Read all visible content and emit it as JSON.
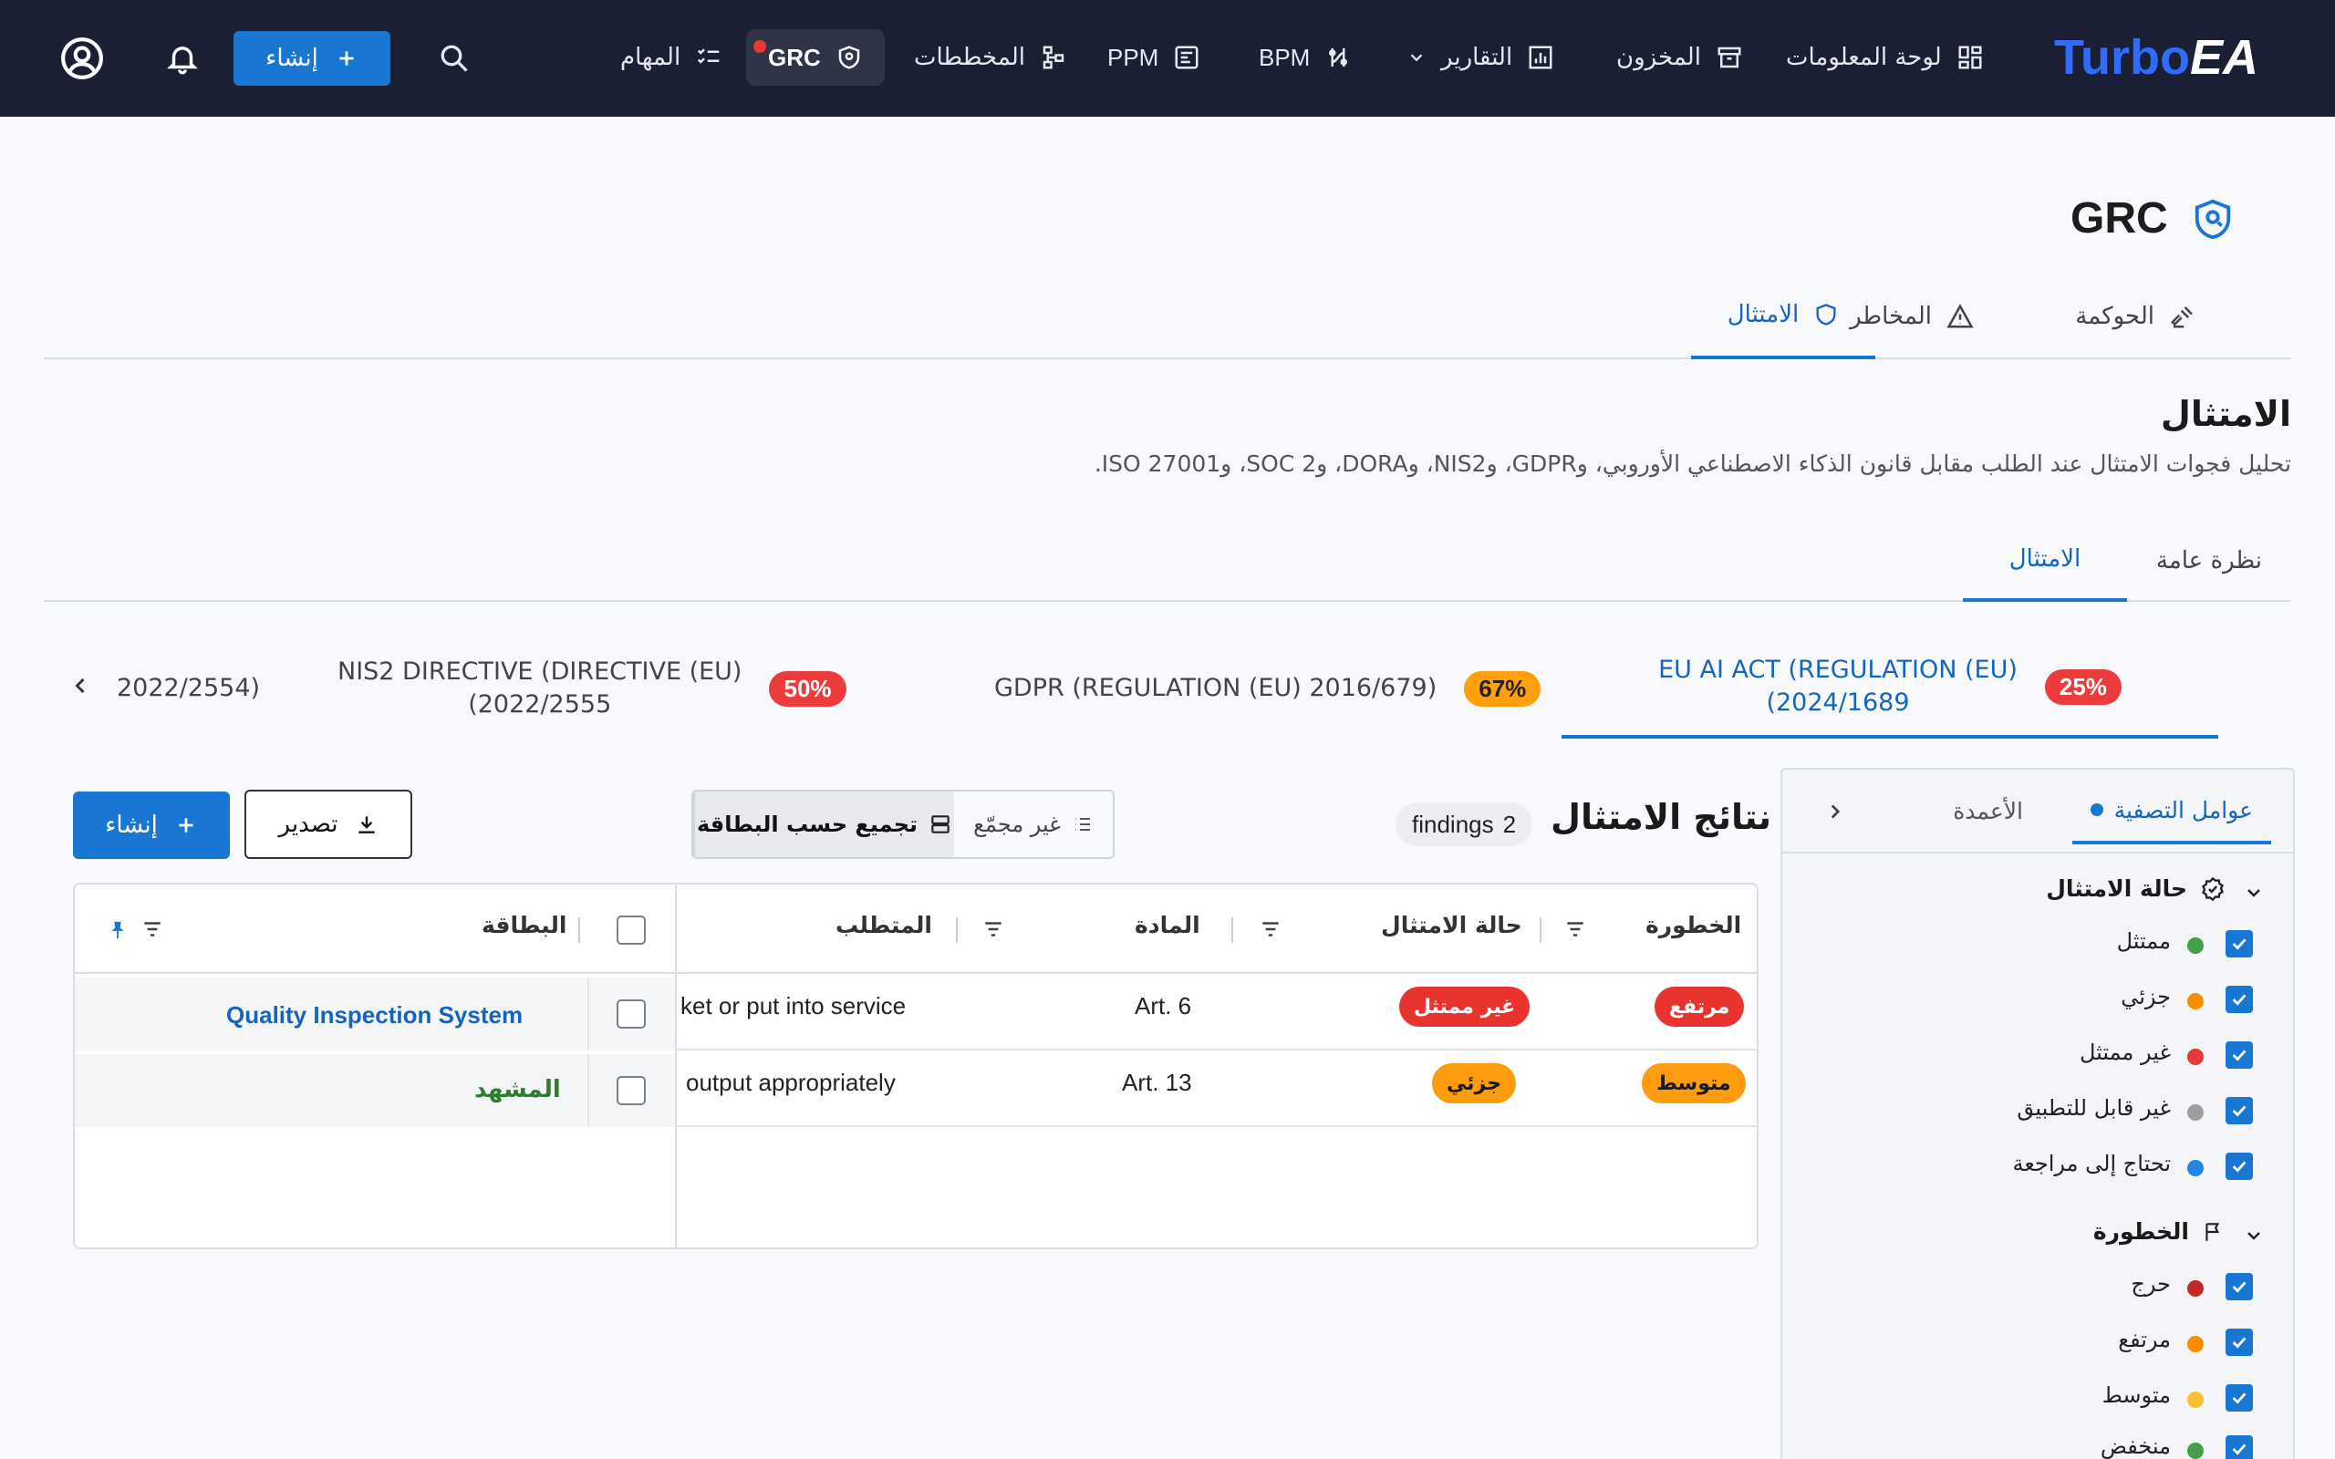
{
  "nav": {
    "logo_a": "Turbo",
    "logo_b": "EA",
    "items": [
      {
        "label": "لوحة المعلومات"
      },
      {
        "label": "المخزون"
      },
      {
        "label": "التقارير"
      },
      {
        "label": "BPM"
      },
      {
        "label": "PPM"
      },
      {
        "label": "المخططات"
      },
      {
        "label": "GRC",
        "active": true
      },
      {
        "label": "المهام"
      }
    ],
    "create_label": "إنشاء"
  },
  "page": {
    "title": "GRC",
    "tabs": [
      {
        "label": "الحوكمة"
      },
      {
        "label": "المخاطر"
      },
      {
        "label": "الامتثال",
        "active": true
      }
    ],
    "section_title": "الامتثال",
    "section_desc": "تحليل فجوات الامتثال عند الطلب مقابل قانون الذكاء الاصطناعي الأوروبي، وGDPR، وNIS2، وDORA، وSOC 2، وISO 27001.",
    "sub_tabs": [
      {
        "label": "نظرة عامة"
      },
      {
        "label": "الامتثال",
        "active": true
      }
    ]
  },
  "regulations": [
    {
      "label_1": "EU AI ACT (REGULATION (EU)",
      "label_2": "2024/1689)",
      "score": "25%",
      "active": true
    },
    {
      "label_1": "GDPR (REGULATION (EU) 2016/679)",
      "label_2": "",
      "score": "67%"
    },
    {
      "label_1": "NIS2 DIRECTIVE (DIRECTIVE (EU)",
      "label_2": "2022/2555)",
      "score": "50%"
    },
    {
      "label_1": "2022/2554)",
      "label_2": ""
    }
  ],
  "filters": {
    "tab_filters": "عوامل التصفية",
    "tab_columns": "الأعمدة",
    "group_status": "حالة الامتثال",
    "status_items": [
      {
        "label": "ممتثل",
        "color": "#43a047"
      },
      {
        "label": "جزئي",
        "color": "#fb8c00"
      },
      {
        "label": "غير ممتثل",
        "color": "#e53935"
      },
      {
        "label": "غير قابل للتطبيق",
        "color": "#9e9e9e"
      },
      {
        "label": "تحتاج إلى مراجعة",
        "color": "#1e88e5"
      }
    ],
    "group_severity": "الخطورة",
    "severity_items": [
      {
        "label": "حرج",
        "color": "#c62828"
      },
      {
        "label": "مرتفع",
        "color": "#fb8c00"
      },
      {
        "label": "متوسط",
        "color": "#fbc02d"
      },
      {
        "label": "منخفض",
        "color": "#43a047"
      }
    ]
  },
  "results": {
    "title": "نتائج الامتثال",
    "findings_count": "2",
    "findings_word": "findings",
    "ungrouped": "غير مجمّع",
    "group_by_card": "تجميع حسب البطاقة",
    "export": "تصدير",
    "create": "إنشاء"
  },
  "table": {
    "headers": {
      "severity": "الخطورة",
      "status": "حالة الامتثال",
      "article": "المادة",
      "requirement": "المتطلب",
      "card": "البطاقة"
    },
    "rows": [
      {
        "severity": "مرتفع",
        "status": "غير ممتثل",
        "article": "Art. 6",
        "requirement": "ket or put into service",
        "card": "Quality Inspection System"
      },
      {
        "severity": "متوسط",
        "status": "جزئي",
        "article": "Art. 13",
        "requirement": "output appropriately",
        "card": "المشهد"
      }
    ]
  }
}
